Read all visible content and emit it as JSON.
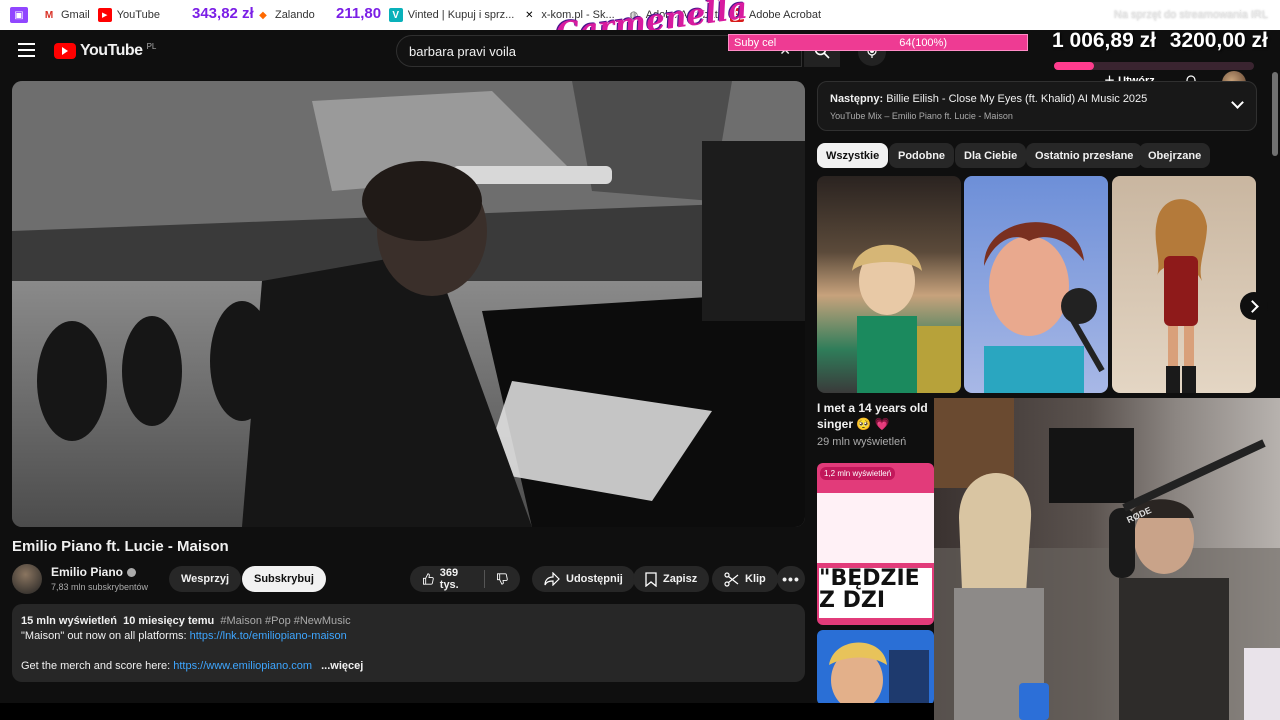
{
  "bookmarks": [
    {
      "label": "Gmail",
      "icon": "gmail-icon",
      "color": "#d93025"
    },
    {
      "label": "YouTube",
      "icon": "youtube-icon",
      "color": "#ff0000"
    },
    {
      "label": "Zalando",
      "icon": "zalando-icon",
      "color": "#ff6900"
    },
    {
      "label": "Vinted | Kupuj i sprz...",
      "icon": "vinted-icon",
      "color": "#09b1ba"
    },
    {
      "label": "x-kom.pl - Sk...",
      "icon": "xkom-icon",
      "color": "#000000"
    },
    {
      "label": "Adobe Acrobat",
      "icon": "globe-icon",
      "color": "#666666"
    },
    {
      "label": "Adobe Acrobat",
      "icon": "acrobat-icon",
      "color": "#d81b1b"
    }
  ],
  "overlay": {
    "donation_1": "343,82 zł",
    "donation_2": "211,80",
    "logo_text": "Carmenella",
    "goal_label": "Suby cel",
    "goal_value": "64(100%)",
    "total_1": "1 006,89 zł",
    "total_2": "3200,00 zł",
    "right_text": "Na sprzęt do streamowania IRL",
    "goal_progress": 0.2
  },
  "header": {
    "logo_text": "YouTube",
    "region": "PL",
    "search_value": "barbara pravi voila",
    "create_label": "Utwórz"
  },
  "video": {
    "title": "Emilio Piano ft. Lucie - Maison",
    "channel": "Emilio Piano",
    "subscribers": "7,83 mln subskrybentów",
    "join_label": "Wesprzyj",
    "subscribe_label": "Subskrybuj",
    "likes": "369 tys.",
    "share_label": "Udostępnij",
    "save_label": "Zapisz",
    "clip_label": "Klip"
  },
  "description": {
    "views": "15 mln wyświetleń",
    "date": "10 miesięcy temu",
    "tags": "#Maison #Pop #NewMusic",
    "line1_prefix": "\"Maison\" out now on all platforms: ",
    "line1_link": "https://lnk.to/emiliopiano-maison",
    "line2_prefix": "Get the merch and score here: ",
    "line2_link": "https://www.emiliopiano.com",
    "more": "...więcej"
  },
  "sidebar": {
    "next_label": "Następny:",
    "next_title": "Billie Eilish - Close My Eyes (ft. Khalid) AI Music 2025",
    "next_sub": "YouTube Mix – Emilio Piano ft. Lucie - Maison",
    "chips": [
      "Wszystkie",
      "Podobne",
      "Dla Ciebie",
      "Ostatnio przesłane",
      "Obejrzane"
    ],
    "short_title": "I met a 14 years old singer 🥺 💗",
    "short_views": "29 mln wyświetleń",
    "thumb_views_badge": "1,2 mln wyświetleń",
    "thumb_caption": "\"BĘDZIE Z DZI",
    "rode_label": "RØDE"
  }
}
